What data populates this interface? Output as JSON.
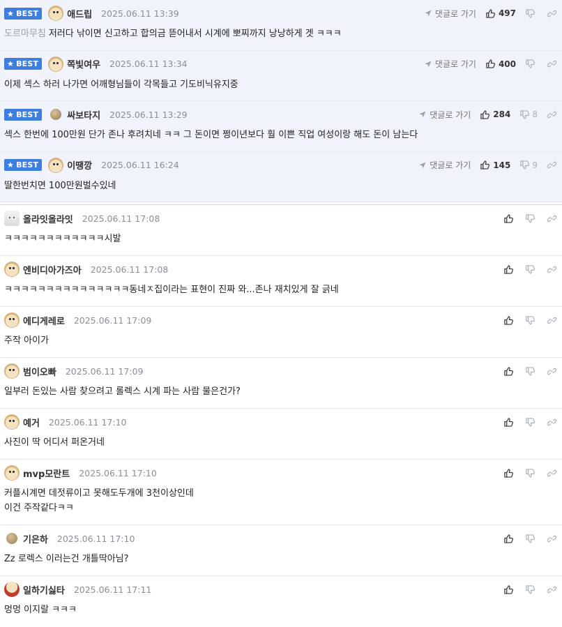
{
  "goto_label": "댓글로 가기",
  "best_label": "BEST",
  "best_comments": [
    {
      "nick": "애드립",
      "date": "2025.06.11 13:39",
      "up": "497",
      "down": "",
      "prefix": "도르마무침",
      "text": "저러다 낚이면 신고하고 합의금 뜯어내서 시계에 뽀찌까지 낭낭하게 겟 ㅋㅋㅋ"
    },
    {
      "nick": "쪽빛여우",
      "date": "2025.06.11 13:34",
      "up": "400",
      "down": "",
      "prefix": "",
      "text": "이제 섹스 하러 나가면 어깨형님들이 각목들고 기도비닉유지중"
    },
    {
      "nick": "싸보타지",
      "date": "2025.06.11 13:29",
      "up": "284",
      "down": "8",
      "prefix": "",
      "text": "섹스 한번에 100만원 단가 존나 후려치네 ㅋㅋ 그 돈이면 쩡이년보다 훨 이쁜 직업 여성이랑 해도 돈이 남는다"
    },
    {
      "nick": "이땡깡",
      "date": "2025.06.11 16:24",
      "up": "145",
      "down": "9",
      "prefix": "",
      "text": "딸한번치면 100만원벌수있네"
    }
  ],
  "comments": [
    {
      "nick": "올라잇올라잇",
      "date": "2025.06.11 17:08",
      "lines": [
        "ㅋㅋㅋㅋㅋㅋㅋㅋㅋㅋㅋㅋ시발"
      ]
    },
    {
      "nick": "엔비디아가즈아",
      "date": "2025.06.11 17:08",
      "lines": [
        "ㅋㅋㅋㅋㅋㅋㅋㅋㅋㅋㅋㅋㅋㅋㅋ동네ㅈ집이라는 표현이 진짜 와...존나 재치있게 잘 긁네"
      ]
    },
    {
      "nick": "에디게레로",
      "date": "2025.06.11 17:09",
      "lines": [
        "주작 아이가"
      ]
    },
    {
      "nick": "범이오빠",
      "date": "2025.06.11 17:09",
      "lines": [
        "일부러 돈있는 사람 찾으려고 롤렉스 시계 파는 사람 물은건가?"
      ]
    },
    {
      "nick": "예거",
      "date": "2025.06.11 17:10",
      "lines": [
        "사진이 딱 어디서 퍼온거네"
      ]
    },
    {
      "nick": "mvp모란트",
      "date": "2025.06.11 17:10",
      "lines": [
        "커플시계면 데젓류이고 못해도두개에 3천이상인데",
        "이건 주작같다ㅋㅋ"
      ]
    },
    {
      "nick": "기은하",
      "date": "2025.06.11 17:10",
      "lines": [
        "Zz 로렉스 이러는건 개틀딱아님?"
      ]
    },
    {
      "nick": "일하기싫타",
      "date": "2025.06.11 17:11",
      "lines": [
        "멍멍 이지랄 ㅋㅋㅋ"
      ]
    }
  ]
}
